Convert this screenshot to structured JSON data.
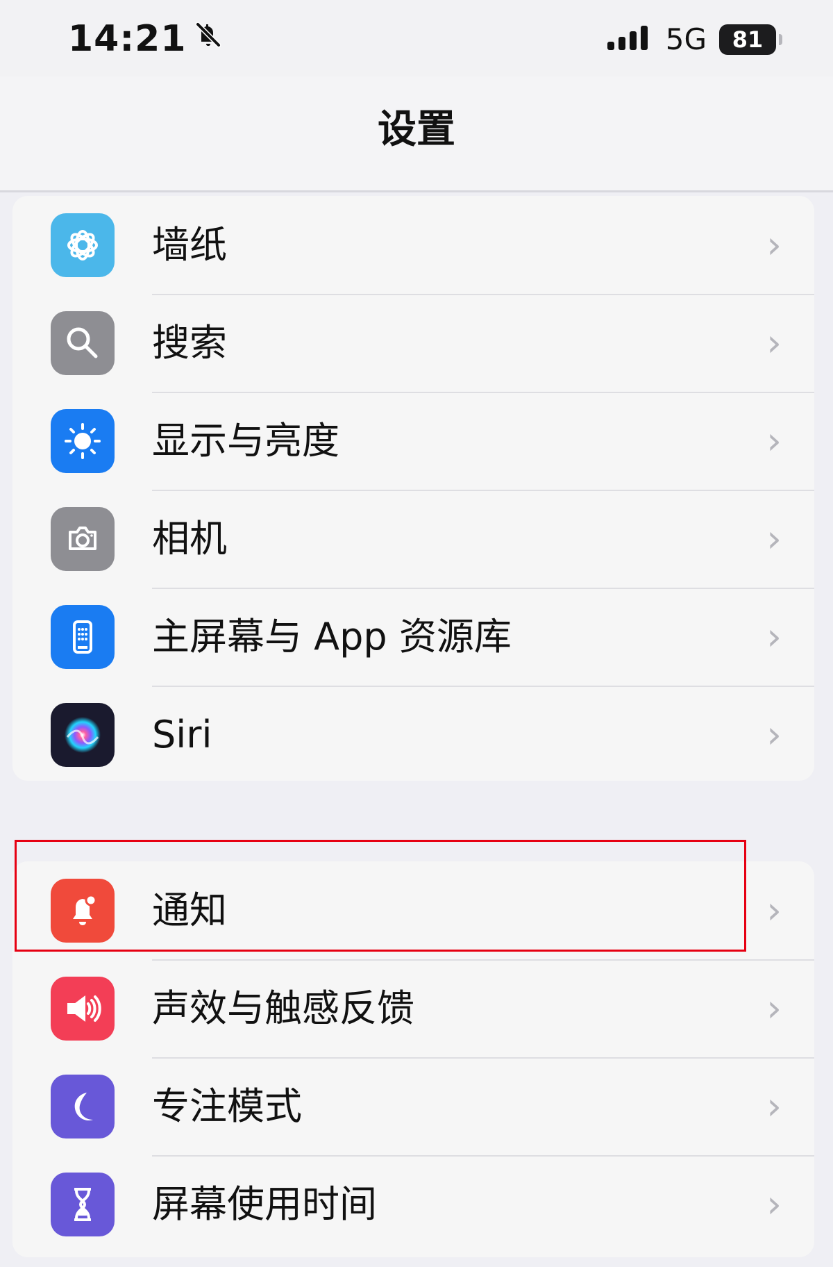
{
  "status_bar": {
    "time": "14:21",
    "network": "5G",
    "battery": "81"
  },
  "nav": {
    "title": "设置"
  },
  "groups": [
    {
      "items": [
        {
          "label": "墙纸",
          "icon": "wallpaper-icon",
          "color": "#4bb7ea"
        },
        {
          "label": "搜索",
          "icon": "search-icon",
          "color": "#8e8e93"
        },
        {
          "label": "显示与亮度",
          "icon": "display-brightness-icon",
          "color": "#1a7cf2"
        },
        {
          "label": "相机",
          "icon": "camera-icon",
          "color": "#8e8e93"
        },
        {
          "label": "主屏幕与 App 资源库",
          "icon": "home-screen-icon",
          "color": "#1a7cf2"
        },
        {
          "label": "Siri",
          "icon": "siri-icon",
          "color": "#1a1a2e"
        }
      ]
    },
    {
      "items": [
        {
          "label": "通知",
          "icon": "notification-bell-icon",
          "color": "#f04a3b"
        },
        {
          "label": "声效与触感反馈",
          "icon": "sound-speaker-icon",
          "color": "#f33e56"
        },
        {
          "label": "专注模式",
          "icon": "focus-moon-icon",
          "color": "#6858d8"
        },
        {
          "label": "屏幕使用时间",
          "icon": "hourglass-icon",
          "color": "#6858d8"
        }
      ]
    }
  ],
  "chevron": "›",
  "highlight_color": "#e60012"
}
